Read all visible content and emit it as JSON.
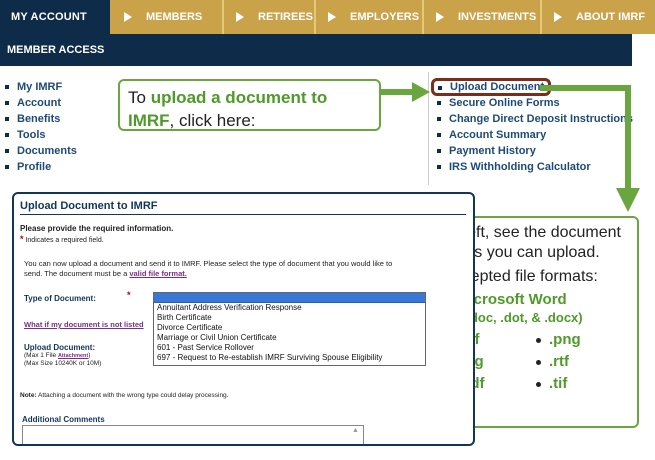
{
  "topnav": {
    "active": "MY ACCOUNT",
    "items": [
      "MEMBERS",
      "RETIREES",
      "EMPLOYERS",
      "INVESTMENTS",
      "ABOUT IMRF"
    ]
  },
  "member_bar": "MEMBER ACCESS",
  "left_links": [
    "My IMRF",
    "Account",
    "Benefits",
    "Tools",
    "Documents",
    "Profile"
  ],
  "right_links": [
    "Upload Document",
    "Secure Online Forms",
    "Change Direct Deposit Instructions",
    "Account Summary",
    "Payment History",
    "IRS Withholding Calculator"
  ],
  "callout1": {
    "text_a": "To ",
    "text_b": "upload a document to IMRF",
    "text_c": ", click here:"
  },
  "callout2": {
    "line1": "At left, see the document types you can upload.",
    "line2": "Accepted file formats:",
    "word": "Microsoft Word",
    "word_ext": "(.doc, .dot, & .docx)",
    "formats": [
      ".gif",
      ".png",
      ".jpg",
      ".rtf",
      ".pdf",
      ".tif"
    ]
  },
  "form": {
    "title": "Upload Document to IMRF",
    "provide": "Please provide the required information.",
    "required_note": "Indicates a required field.",
    "intro_a": "You can now upload a document and send it to IMRF. Please select the type of document that you would like to send. The document must be a ",
    "intro_link": "valid file format.",
    "type_label": "Type of Document:",
    "what_if": "What if my document is not listed",
    "options": [
      "Annuitant Address Verification Response",
      "Birth Certificate",
      "Divorce Certificate",
      "Marriage or Civil Union Certificate",
      "601 - Past Service Rollover",
      "697 - Request to Re-establish IMRF Surviving Spouse Eligibility"
    ],
    "upload_label": "Upload Document:",
    "max_file_a": "(Max 1 File ",
    "max_file_link": "Attachment",
    "max_file_b": ")",
    "max_size": "(Max Size 10240K or 10M)",
    "note_label": "Note:",
    "note_text": " Attaching a document with the wrong type could delay processing.",
    "additional": "Additional Comments"
  },
  "colors": {
    "navy": "#0e2c4a",
    "gold": "#c9a24a",
    "green": "#6aa640",
    "link_blue": "#1e4a7a",
    "highlight": "#7a2d1b"
  }
}
